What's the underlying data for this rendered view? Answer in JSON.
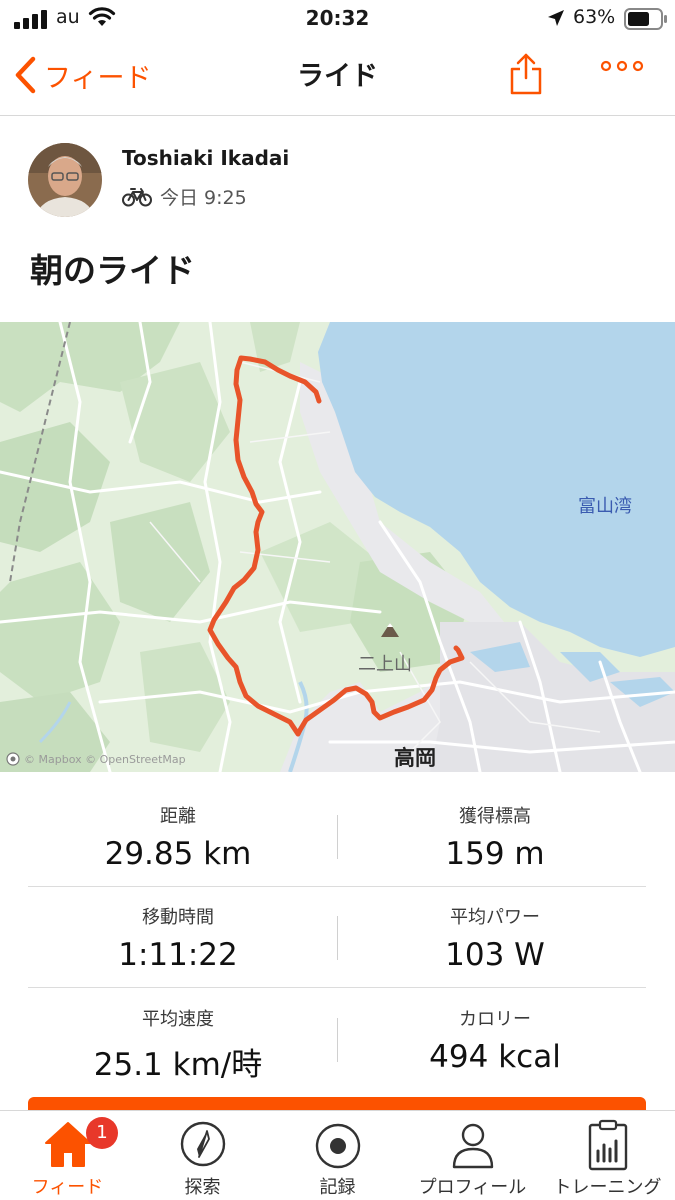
{
  "status_bar": {
    "carrier": "au",
    "time": "20:32",
    "battery": "63%"
  },
  "nav": {
    "back_label": "フィード",
    "title": "ライド"
  },
  "athlete": {
    "name": "Toshiaki Ikadai",
    "time": "今日 9:25"
  },
  "activity": {
    "title": "朝のライド"
  },
  "map": {
    "bay_label": "富山湾",
    "mountain_label": "二上山",
    "city_label": "高岡",
    "attribution": "© Mapbox © OpenStreetMap",
    "route_color": "#e8542a",
    "water_color": "#b3d5eb",
    "land_color": "#e2efdc"
  },
  "stats": [
    {
      "label": "距離",
      "value": "29.85 km"
    },
    {
      "label": "獲得標高",
      "value": "159 m"
    },
    {
      "label": "移動時間",
      "value": "1:11:22"
    },
    {
      "label": "平均パワー",
      "value": "103 W"
    },
    {
      "label": "平均速度",
      "value": "25.1 km/時"
    },
    {
      "label": "カロリー",
      "value": "494 kcal"
    }
  ],
  "tabbar": {
    "items": [
      {
        "label": "フィード",
        "icon": "home-icon",
        "badge": "1"
      },
      {
        "label": "探索",
        "icon": "compass-icon"
      },
      {
        "label": "記録",
        "icon": "record-icon"
      },
      {
        "label": "プロフィール",
        "icon": "profile-icon"
      },
      {
        "label": "トレーニング",
        "icon": "training-icon"
      }
    ]
  },
  "colors": {
    "accent": "#fc5200",
    "badge": "#e8382a"
  }
}
